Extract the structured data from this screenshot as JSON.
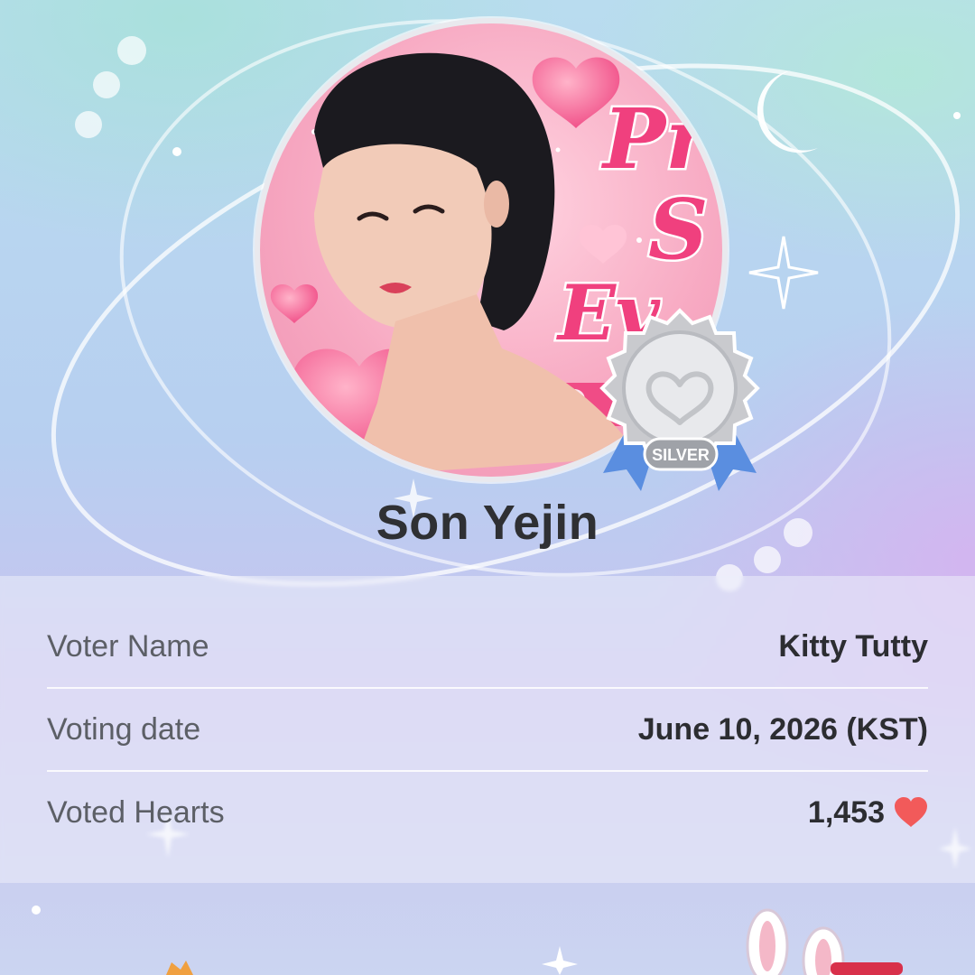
{
  "idol": {
    "name": "Son Yejin",
    "badge_text": "SILVER",
    "artwork_text": [
      "Pr",
      "S",
      "Ev"
    ]
  },
  "vote_info": {
    "rows": [
      {
        "label": "Voter Name",
        "value": "Kitty Tutty"
      },
      {
        "label": "Voting date",
        "value": "June 10, 2026 (KST)"
      },
      {
        "label": "Voted Hearts",
        "value": "1,453",
        "icon": "heart-icon"
      }
    ]
  },
  "colors": {
    "heart": "#f25a5a",
    "text_dark": "#2c2d31",
    "text_label": "#5c5f66"
  }
}
